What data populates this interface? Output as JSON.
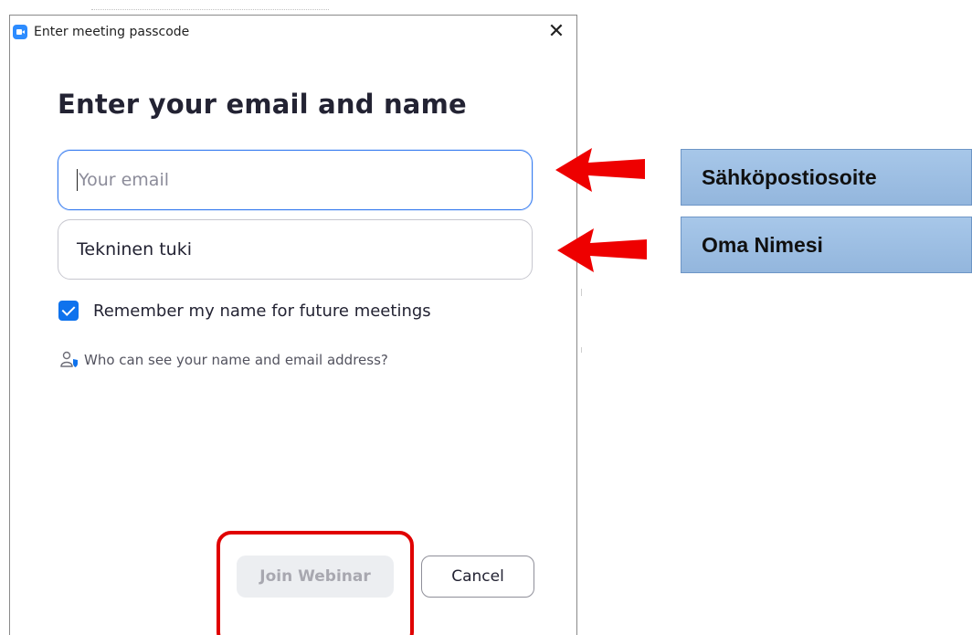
{
  "dialog": {
    "title": "Enter meeting passcode",
    "close_symbol": "✕",
    "heading": "Enter your email and name",
    "email_field": {
      "value": "",
      "placeholder": "Your email"
    },
    "name_field": {
      "value": "Tekninen tuki"
    },
    "remember_checkbox": {
      "checked": true,
      "label": "Remember my name for future meetings"
    },
    "privacy_link": {
      "label": "Who can see your name and email address?",
      "icon": "user-shield-icon"
    },
    "buttons": {
      "join_label": "Join Webinar",
      "cancel_label": "Cancel"
    }
  },
  "annotations": {
    "email_callout": "Sähköpostiosoite",
    "name_callout": "Oma Nimesi",
    "arrow_color": "#ee0000",
    "callout_color": "#9bbde3"
  },
  "colors": {
    "accent_blue": "#0e72ed",
    "zoom_blue": "#2d8cff",
    "annotation_red": "#e00000"
  }
}
